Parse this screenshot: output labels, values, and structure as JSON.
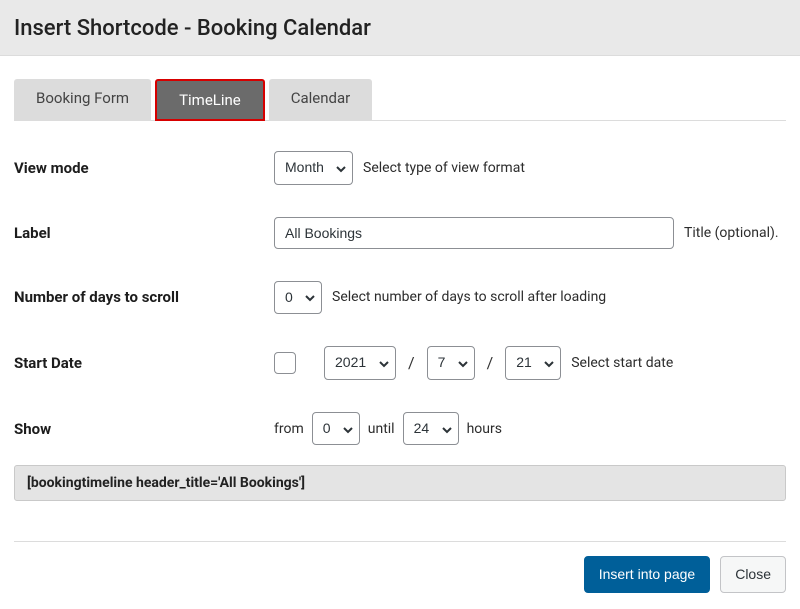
{
  "header": {
    "title": "Insert Shortcode - Booking Calendar"
  },
  "tabs": {
    "items": [
      {
        "label": "Booking Form"
      },
      {
        "label": "TimeLine"
      },
      {
        "label": "Calendar"
      }
    ],
    "active_index": 1
  },
  "form": {
    "view_mode": {
      "label": "View mode",
      "value": "Month",
      "hint": "Select type of view format"
    },
    "label_field": {
      "label": "Label",
      "value": "All Bookings",
      "hint": "Title (optional)."
    },
    "scroll_days": {
      "label": "Number of days to scroll",
      "value": "0",
      "hint": "Select number of days to scroll after loading"
    },
    "start_date": {
      "label": "Start Date",
      "checked": false,
      "year": "2021",
      "month": "7",
      "day": "21",
      "hint": "Select start date",
      "slash": "/"
    },
    "show": {
      "label": "Show",
      "from_text": "from",
      "from_value": "0",
      "until_text": "until",
      "until_value": "24",
      "hours_text": "hours"
    }
  },
  "shortcode": "[bookingtimeline header_title='All Bookings']",
  "footer": {
    "insert": "Insert into page",
    "close": "Close"
  }
}
